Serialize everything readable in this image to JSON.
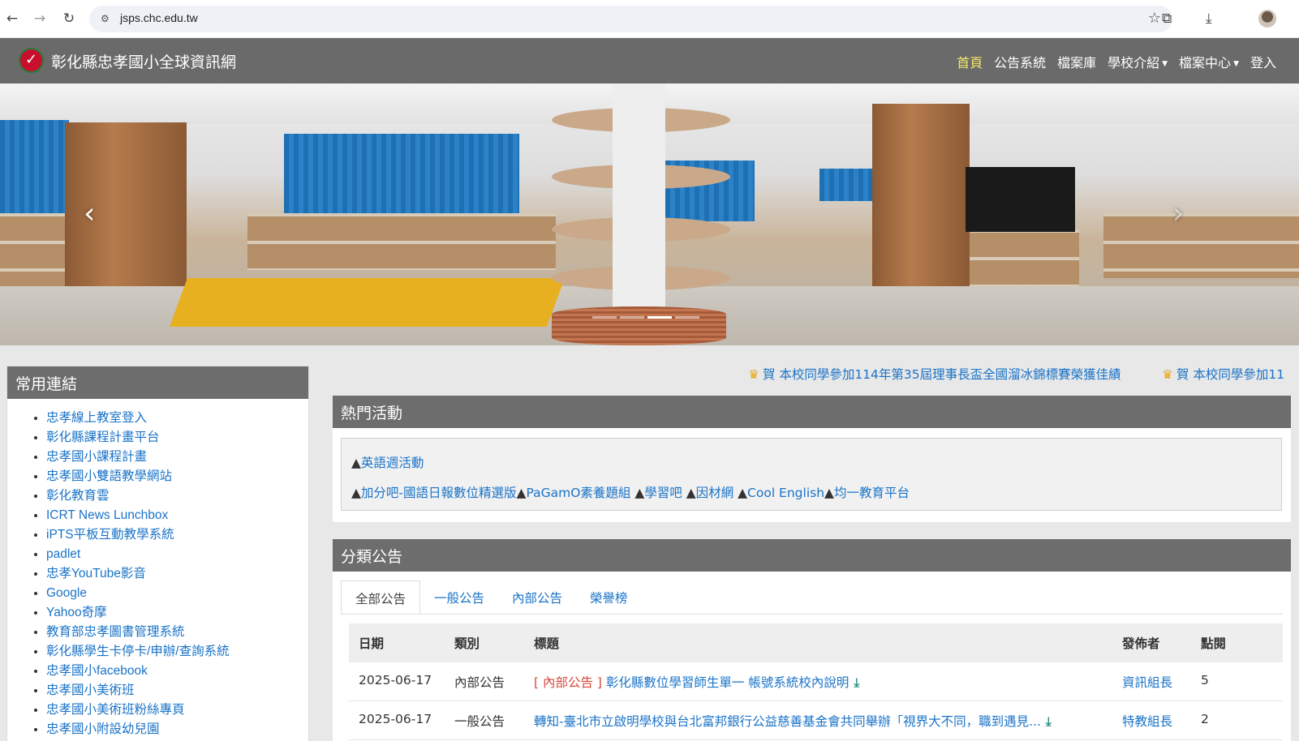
{
  "browser": {
    "url": "jsps.chc.edu.tw"
  },
  "navbar": {
    "site_title": "彰化縣忠孝國小全球資訊網",
    "menu": [
      {
        "label": "首頁",
        "active": true,
        "dropdown": false
      },
      {
        "label": "公告系統",
        "active": false,
        "dropdown": false
      },
      {
        "label": "檔案庫",
        "active": false,
        "dropdown": false
      },
      {
        "label": "學校介紹",
        "active": false,
        "dropdown": true
      },
      {
        "label": "檔案中心",
        "active": false,
        "dropdown": true
      },
      {
        "label": "登入",
        "active": false,
        "dropdown": false
      }
    ],
    "active_color": "#f5e66b"
  },
  "carousel": {
    "prev_icon": "chevron-left-icon",
    "next_icon": "chevron-right-icon",
    "slide_count": 4,
    "active_slide": 3
  },
  "sidebar": {
    "title": "常用連結",
    "links": [
      "忠孝線上教室登入",
      "彰化縣課程計畫平台",
      "忠孝國小課程計畫",
      "忠孝國小雙語教學網站",
      "彰化教育雲",
      "ICRT News Lunchbox",
      "iPTS平板互動教學系統",
      "padlet",
      "忠孝YouTube影音",
      "Google",
      "Yahoo奇摩",
      "教育部忠孝圖書管理系統",
      "彰化縣學生卡停卡/申辦/查詢系統",
      "忠孝國小facebook",
      "忠孝國小美術班",
      "忠孝國小美術班粉絲專頁",
      "忠孝國小附設幼兒園"
    ]
  },
  "marquee": {
    "items": [
      "賀 本校同學參加114年第35屆理事長盃全國溜冰錦標賽榮獲佳績",
      "賀 本校同學參加11"
    ]
  },
  "hot_activities": {
    "title": "熱門活動",
    "row1": [
      "英語週活動"
    ],
    "row2": [
      "加分吧-國語日報數位精選版",
      "PaGamO素養題組",
      "學習吧",
      "因材網",
      "Cool English",
      "均一教育平台"
    ],
    "bullet": "▲"
  },
  "announcements": {
    "title": "分類公告",
    "tabs": [
      "全部公告",
      "一般公告",
      "內部公告",
      "榮譽榜"
    ],
    "active_tab": 0,
    "columns": [
      "日期",
      "類別",
      "標題",
      "發佈者",
      "點閱"
    ],
    "rows": [
      {
        "date": "2025-06-17",
        "category": "內部公告",
        "tag": "[ 內部公告 ]",
        "title": "彰化縣數位學習師生單一 帳號系統校內說明",
        "publisher": "資訊組長",
        "hits": "5"
      },
      {
        "date": "2025-06-17",
        "category": "一般公告",
        "tag": "",
        "title": "轉知-臺北市立啟明學校與台北富邦銀行公益慈善基金會共同舉辦「視界大不同，職到遇見...",
        "publisher": "特教組長",
        "hits": "2"
      }
    ]
  }
}
